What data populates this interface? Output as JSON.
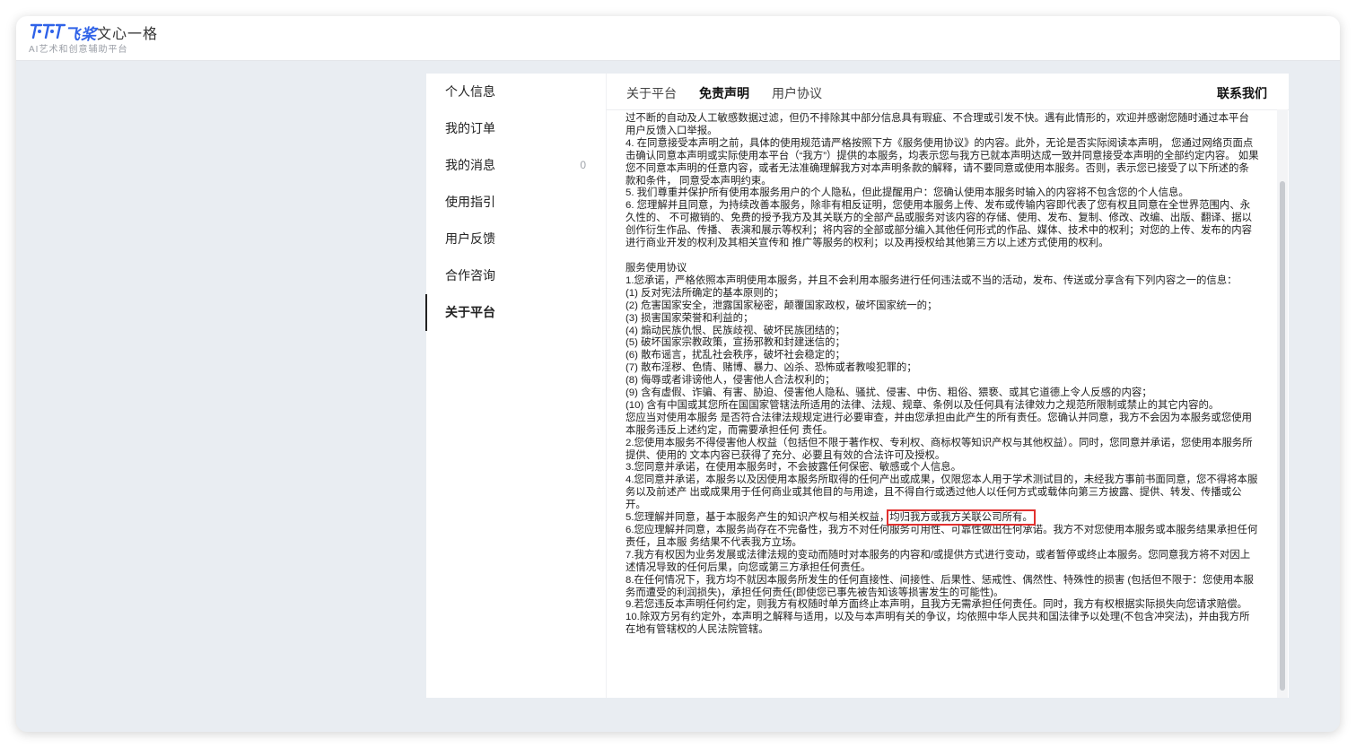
{
  "logo": {
    "brand": "飞桨",
    "name": "文心一格",
    "slogan": "AI艺术和创意辅助平台"
  },
  "sidebar": {
    "items": [
      {
        "label": "个人信息"
      },
      {
        "label": "我的订单"
      },
      {
        "label": "我的消息",
        "badge": "0"
      },
      {
        "label": "使用指引"
      },
      {
        "label": "用户反馈"
      },
      {
        "label": "合作咨询"
      },
      {
        "label": "关于平台",
        "active": true
      }
    ]
  },
  "tabs": [
    {
      "label": "关于平台"
    },
    {
      "label": "免责声明",
      "active": true
    },
    {
      "label": "用户协议"
    }
  ],
  "contact_label": "联系我们",
  "disclaimer": {
    "p3": "过不断的自动及人工敏感数据过滤，但仍不排除其中部分信息具有瑕疵、不合理或引发不快。遇有此情形的，欢迎并感谢您随时通过本平台用户反馈入口举报。",
    "p4": "4. 在同意接受本声明之前，具体的使用规范请严格按照下方《服务使用协议》的内容。此外，无论是否实际阅读本声明， 您通过网络页面点击确认同意本声明或实际使用本平台（“我方”）提供的本服务，均表示您与我方已就本声明达成一致并同意接受本声明的全部约定内容。 如果您不同意本声明的任意内容，或者无法准确理解我方对本声明条款的解释，请不要同意或使用本服务。否则，表示您已接受了以下所述的条款和条件， 同意受本声明约束。",
    "p5": "5. 我们尊重并保护所有使用本服务用户的个人隐私，但此提醒用户：您确认使用本服务时输入的内容将不包含您的个人信息。",
    "p6": "6. 您理解并且同意，为持续改善本服务，除非有相反证明，您使用本服务上传、发布或传输内容即代表了您有权且同意在全世界范围内、永久性的、 不可撤销的、免费的授予我方及其关联方的全部产品或服务对该内容的存储、使用、发布、复制、修改、改编、出版、翻译、据以创作衍生作品、传播、 表演和展示等权利；将内容的全部或部分编入其他任何形式的作品、媒体、技术中的权利；对您的上传、发布的内容进行商业开发的权利及其相关宣传和 推广等服务的权利；以及再授权给其他第三方以上述方式使用的权利。"
  },
  "agreement": {
    "title": "服务使用协议",
    "c1": "1.您承诺，严格依照本声明使用本服务，并且不会利用本服务进行任何违法或不当的活动，发布、传送或分享含有下列内容之一的信息：",
    "c1_items": [
      "(1) 反对宪法所确定的基本原则的；",
      "(2) 危害国家安全，泄露国家秘密，颠覆国家政权，破坏国家统一的；",
      "(3) 损害国家荣誉和利益的；",
      "(4) 煽动民族仇恨、民族歧视、破坏民族团结的；",
      "(5) 破坏国家宗教政策，宣扬邪教和封建迷信的；",
      "(6) 散布谣言，扰乱社会秩序，破坏社会稳定的；",
      "(7) 散布淫秽、色情、赌博、暴力、凶杀、恐怖或者教唆犯罪的；",
      "(8) 侮辱或者诽谤他人，侵害他人合法权利的；",
      "(9) 含有虚假、诈骗、有害、胁迫、侵害他人隐私、骚扰、侵害、中伤、粗俗、猥亵、或其它道德上令人反感的内容；",
      "(10) 含有中国或其您所在国国家管辖法所适用的法律、法规、规章、条例以及任何具有法律效力之规范所限制或禁止的其它内容的。"
    ],
    "c1_tail": "您应当对使用本服务 是否符合法律法规规定进行必要审查，并由您承担由此产生的所有责任。您确认并同意，我方不会因为本服务或您使用本服务违反上述约定，而需要承担任何 责任。",
    "c2": "2.您使用本服务不得侵害他人权益（包括但不限于著作权、专利权、商标权等知识产权与其他权益）。同时，您同意并承诺，您使用本服务所提供、使用的 文本内容已获得了充分、必要且有效的合法许可及授权。",
    "c3": "3.您同意并承诺，在使用本服务时，不会披露任何保密、敏感或个人信息。",
    "c4": "4.您同意并承诺，本服务以及因使用本服务所取得的任何产出或成果，仅限您本人用于学术测试目的，未经我方事前书面同意，您不得将本服务以及前述产 出或成果用于任何商业或其他目的与用途，且不得自行或透过他人以任何方式或载体向第三方披露、提供、转发、传播或公开。",
    "c5_a": "5.您理解并同意，基于本服务产生的知识产权与相关权益，",
    "c5_b": "均归我方或我方关联公司所有。",
    "c6": "6.您应理解并同意，本服务尚存在不完备性，我方不对任何服务可用性、可靠性做出任何承诺。我方不对您使用本服务或本服务结果承担任何责任，且本服 务结果不代表我方立场。",
    "c7": "7.我方有权因为业务发展或法律法规的变动而随时对本服务的内容和/或提供方式进行变动，或者暂停或终止本服务。您同意我方将不对因上述情况导致的任何后果，向您或第三方承担任何责任。",
    "c8": "8.在任何情况下，我方均不就因本服务所发生的任何直接性、间接性、后果性、惩戒性、偶然性、特殊性的损害 (包括但不限于：您使用本服务而遭受的利润损失)，承担任何责任(即使您已事先被告知该等损害发生的可能性)。",
    "c9": "9.若您违反本声明任何约定，则我方有权随时单方面终止本声明，且我方无需承担任何责任。同时，我方有权根据实际损失向您请求赔偿。",
    "c10": "10.除双方另有约定外，本声明之解释与适用，以及与本声明有关的争议，均依照中华人民共和国法律予以处理(不包含冲突法)，并由我方所在地有管辖权的人民法院管辖。"
  }
}
